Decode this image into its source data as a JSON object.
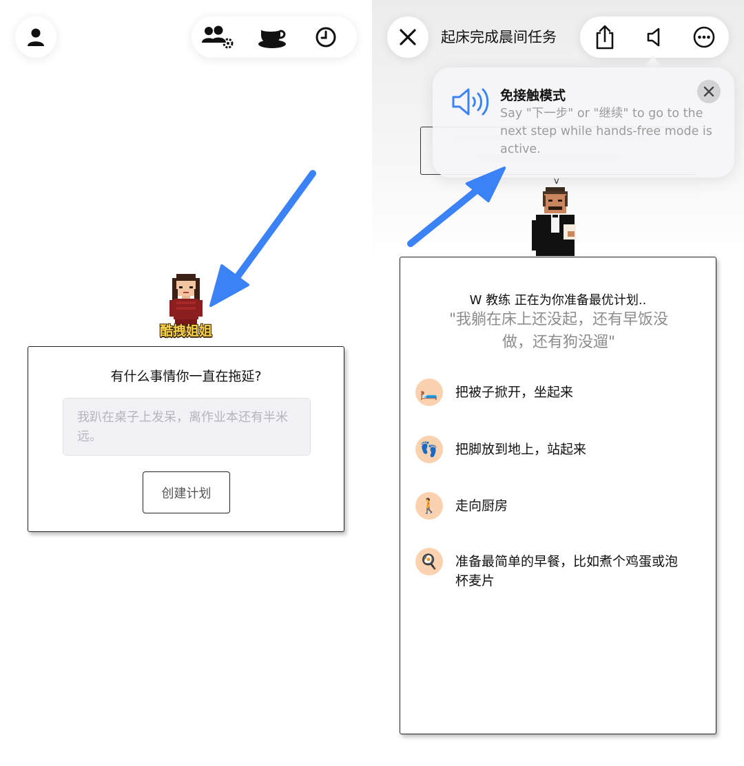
{
  "left_screen": {
    "character_name": "酷拽姐姐",
    "question_card": {
      "title": "有什么事情你一直在拖延?",
      "input_placeholder": "我趴在桌子上发呆，离作业本还有半米远。",
      "create_button": "创建计划"
    },
    "top_icons": [
      "person-icon",
      "group-settings-icon",
      "coffee-cup-icon",
      "clock-icon"
    ]
  },
  "right_screen": {
    "task_title": "起床完成晨间任务",
    "top_icons": [
      "close-icon",
      "share-icon",
      "speaker-icon",
      "more-icon"
    ],
    "popup": {
      "title": "免接触模式",
      "description": "Say \"下一步\" or \"继续\" to go to the next step while hands-free mode is active."
    },
    "butler_label": "v",
    "plan_card": {
      "coach_line": "W 教练 正在为你准备最优计划..",
      "quote": "\"我躺在床上还没起，还有早饭没做，还有狗没遛\"",
      "steps": [
        {
          "icon": "🛏️",
          "icon_name": "bed-icon",
          "text": "把被子掀开，坐起来"
        },
        {
          "icon": "👣",
          "icon_name": "footprints-icon",
          "text": "把脚放到地上，站起来"
        },
        {
          "icon": "🚶",
          "icon_name": "walking-person-icon",
          "text": "走向厨房"
        },
        {
          "icon": "🍳",
          "icon_name": "frying-pan-icon",
          "text": "准备最简单的早餐，比如煮个鸡蛋或泡杯麦片"
        }
      ]
    }
  },
  "colors": {
    "arrow": "#3b82f6",
    "name_tag": "#f6d24c",
    "step_icon_bg": "#fbd2b0",
    "popup_speaker": "#3b82f6"
  }
}
